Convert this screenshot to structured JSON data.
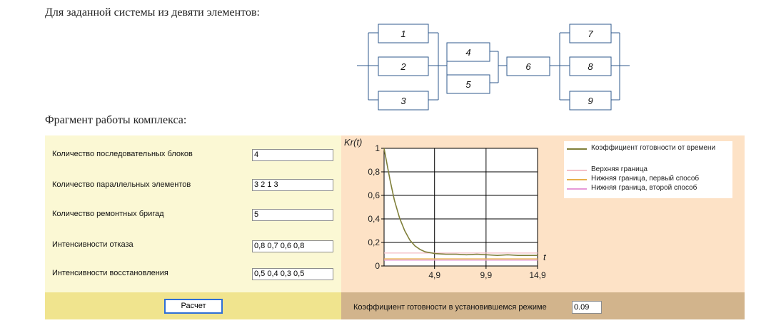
{
  "headings": {
    "system": "Для заданной системы из девяти элементов:",
    "fragment": "Фрагмент работы комплекса:"
  },
  "diagram": {
    "elements": [
      "1",
      "2",
      "3",
      "4",
      "5",
      "6",
      "7",
      "8",
      "9"
    ]
  },
  "form": {
    "serial_blocks_label": "Количество последовательных блоков",
    "serial_blocks_value": "4",
    "parallel_label": "Количество параллельных элементов",
    "parallel_value": "3 2 1 3",
    "brigades_label": "Количество ремонтных бригад",
    "brigades_value": "5",
    "failure_label": "Интенсивности отказа",
    "failure_value": "0,8 0,7 0,6 0,8",
    "repair_label": "Интенсивности восстановления",
    "repair_value": "0,5 0,4 0,3 0,5",
    "calc_button": "Расчет"
  },
  "result": {
    "steady_label": "Коэффициент готовности в установившемся режиме",
    "steady_value": "0.09"
  },
  "colors": {
    "series_main": "#7f7f3a",
    "upper_bound": "#f4c0c8",
    "lower_bound_1": "#e7b04b",
    "lower_bound_2": "#e69ad8"
  },
  "chart_data": {
    "type": "line",
    "ylabel": "Kr(t)",
    "xlabel": "t",
    "xlim": [
      0,
      14.9
    ],
    "ylim": [
      0,
      1
    ],
    "x_ticks": [
      "4,9",
      "9,9",
      "14,9"
    ],
    "y_ticks": [
      "0",
      "0,2",
      "0,4",
      "0,6",
      "0,8",
      "1"
    ],
    "grid": true,
    "legend_position": "right",
    "series": [
      {
        "name": "Коэффициент готовности от времени",
        "x": [
          0,
          0.3,
          0.6,
          1,
          1.5,
          2,
          2.5,
          3,
          3.5,
          4,
          5,
          6,
          7,
          8,
          9,
          10,
          11,
          12,
          13,
          14,
          14.9
        ],
        "y": [
          1,
          0.86,
          0.72,
          0.56,
          0.41,
          0.3,
          0.22,
          0.17,
          0.14,
          0.12,
          0.105,
          0.1,
          0.1,
          0.095,
          0.1,
          0.095,
          0.09,
          0.095,
          0.09,
          0.09,
          0.09
        ]
      },
      {
        "name": "Верхняя граница",
        "x": [
          0,
          14.9
        ],
        "y": [
          0.11,
          0.11
        ]
      },
      {
        "name": "Нижняя граница, первый способ",
        "x": [
          0,
          14.9
        ],
        "y": [
          0.06,
          0.06
        ]
      },
      {
        "name": "Нижняя граница, второй способ",
        "x": [
          0,
          14.9
        ],
        "y": [
          0.05,
          0.05
        ]
      }
    ]
  }
}
